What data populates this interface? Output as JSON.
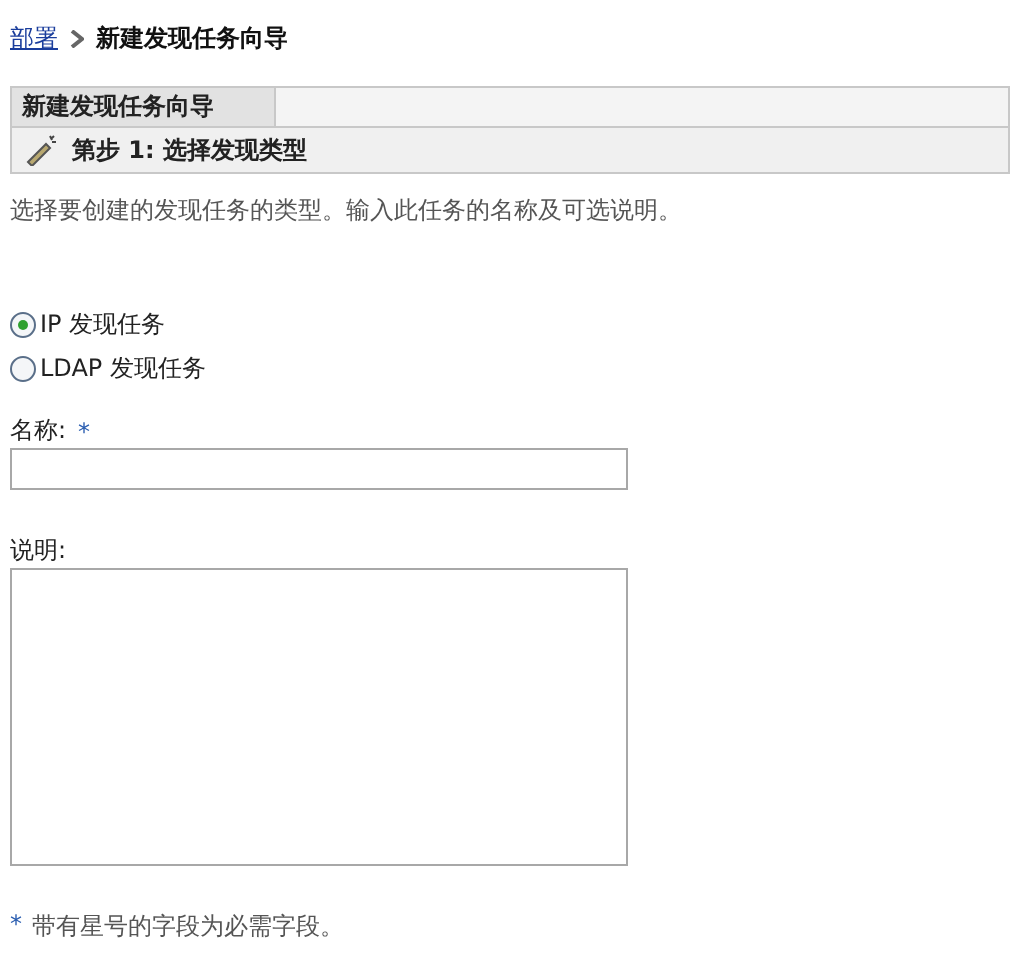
{
  "breadcrumb": [
    {
      "label": "部署",
      "kind": "link"
    },
    {
      "label": "新建发现任务向导",
      "kind": "current"
    }
  ],
  "wizard": {
    "tab": "新建发现任务向导",
    "step": "第步 1: 选择发现类型"
  },
  "intro": "选择要创建的发现任务的类型。输入此任务的名称及可选说明。",
  "options": [
    {
      "label": "IP 发现任务",
      "selected": true
    },
    {
      "label": "LDAP 发现任务",
      "selected": false
    }
  ],
  "fields": [
    {
      "kind": "input",
      "label": "名称:",
      "required": true
    },
    {
      "kind": "textarea",
      "label": "说明:",
      "required": false
    }
  ],
  "footnote": {
    "mark": "*",
    "text": "带有星号的字段为必需字段。"
  }
}
